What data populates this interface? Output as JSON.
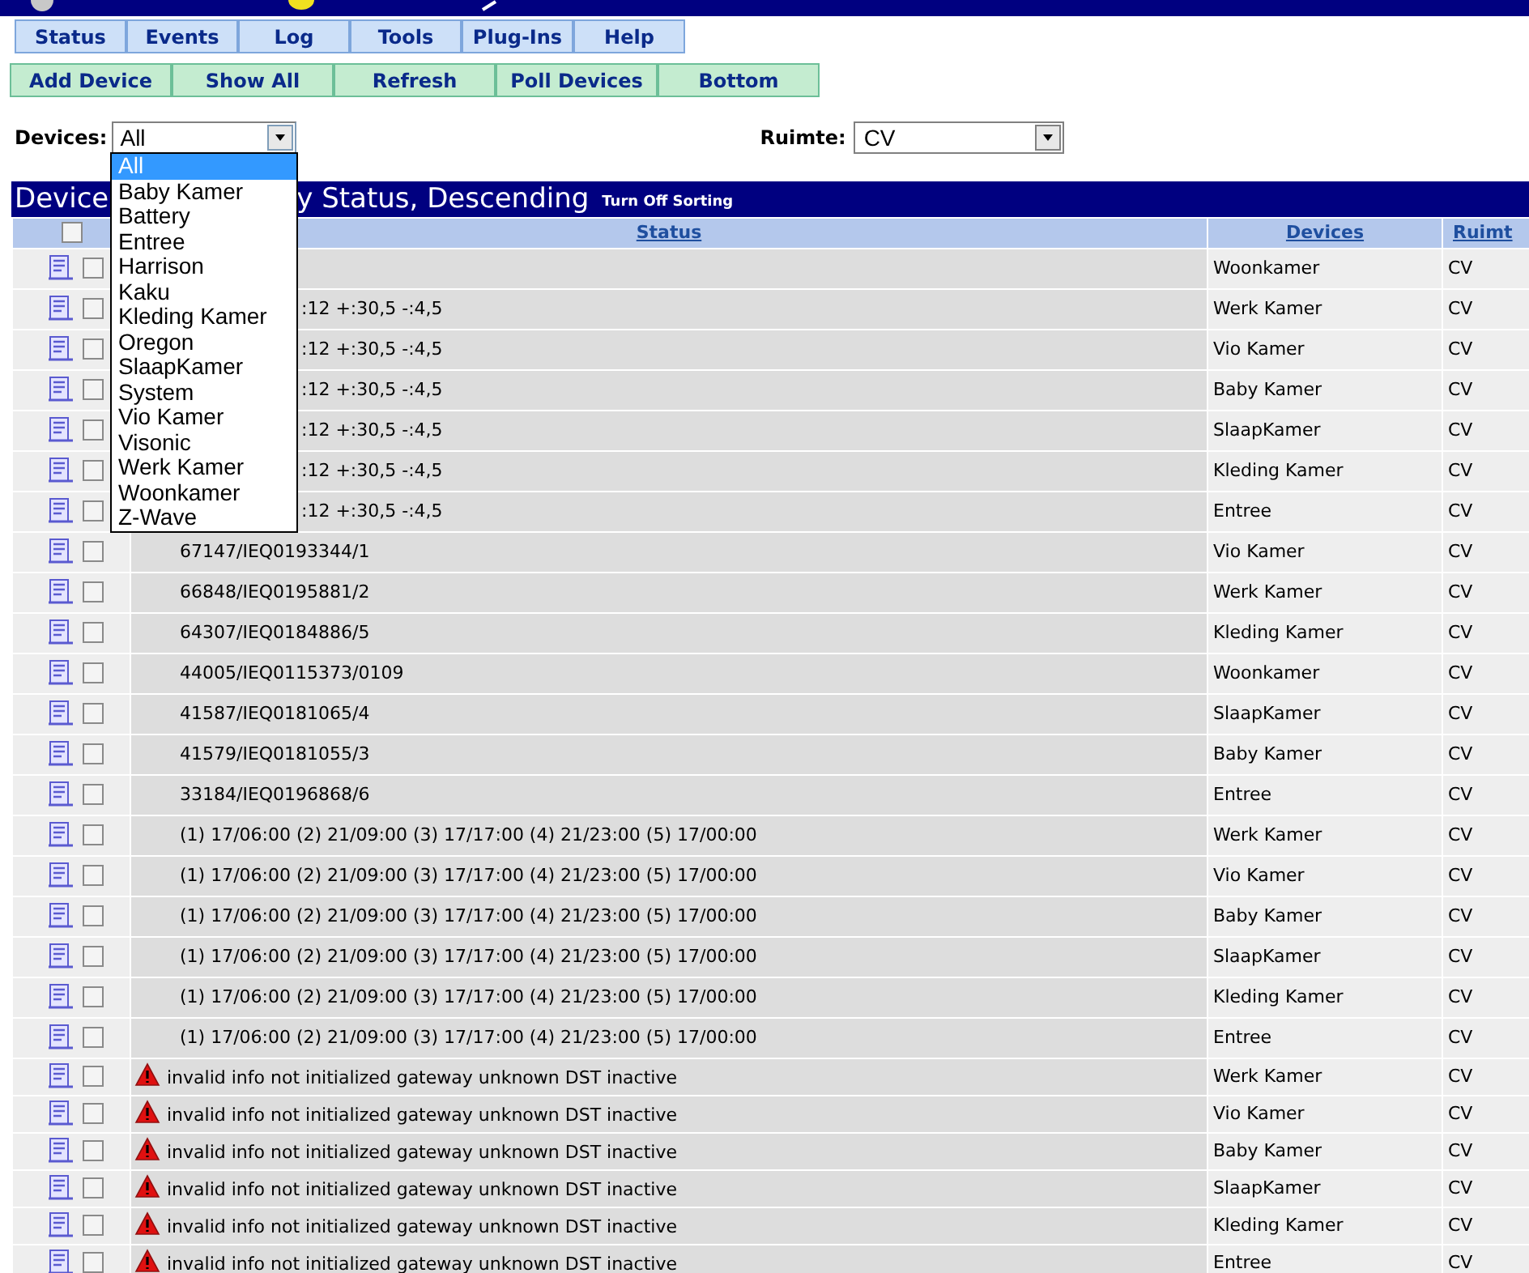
{
  "menu": [
    {
      "label": "Status"
    },
    {
      "label": "Events"
    },
    {
      "label": "Log"
    },
    {
      "label": "Tools"
    },
    {
      "label": "Plug-Ins"
    },
    {
      "label": "Help"
    }
  ],
  "actions": [
    {
      "label": "Add Device"
    },
    {
      "label": "Show All"
    },
    {
      "label": "Refresh"
    },
    {
      "label": "Poll Devices"
    },
    {
      "label": "Bottom"
    }
  ],
  "filters": {
    "devices_label": "Devices:",
    "devices_value": "All",
    "ruimte_label": "Ruimte:",
    "ruimte_value": "CV"
  },
  "devices_dropdown": [
    {
      "label": "All",
      "selected": true
    },
    {
      "label": "Baby Kamer",
      "selected": false
    },
    {
      "label": "Battery",
      "selected": false
    },
    {
      "label": "Entree",
      "selected": false
    },
    {
      "label": "Harrison",
      "selected": false
    },
    {
      "label": "Kaku",
      "selected": false
    },
    {
      "label": "Kleding Kamer",
      "selected": false
    },
    {
      "label": "Oregon",
      "selected": false
    },
    {
      "label": "SlaapKamer",
      "selected": false
    },
    {
      "label": "System",
      "selected": false
    },
    {
      "label": "Vio Kamer",
      "selected": false
    },
    {
      "label": "Visonic",
      "selected": false
    },
    {
      "label": "Werk Kamer",
      "selected": false
    },
    {
      "label": "Woonkamer",
      "selected": false
    },
    {
      "label": "Z-Wave",
      "selected": false
    }
  ],
  "table": {
    "title_left": "Device",
    "title_right": "y Status, Descending",
    "turn_off_sorting": "Turn Off Sorting",
    "select_all_checked": false,
    "columns": [
      "Status",
      "Devices",
      "Ruimt"
    ],
    "rows": [
      {
        "kind": "plain",
        "status": "",
        "device": "Woonkamer",
        "ruimte": "CV",
        "checked": false
      },
      {
        "kind": "partial",
        "status": ":12 +:30,5 -:4,5",
        "device": "Werk Kamer",
        "ruimte": "CV",
        "checked": false
      },
      {
        "kind": "partial",
        "status": ":12 +:30,5 -:4,5",
        "device": "Vio Kamer",
        "ruimte": "CV",
        "checked": false
      },
      {
        "kind": "partial",
        "status": ":12 +:30,5 -:4,5",
        "device": "Baby Kamer",
        "ruimte": "CV",
        "checked": false
      },
      {
        "kind": "partial",
        "status": ":12 +:30,5 -:4,5",
        "device": "SlaapKamer",
        "ruimte": "CV",
        "checked": false
      },
      {
        "kind": "partial",
        "status": ":12 +:30,5 -:4,5",
        "device": "Kleding Kamer",
        "ruimte": "CV",
        "checked": false
      },
      {
        "kind": "partial",
        "status": ":12 +:30,5 -:4,5",
        "device": "Entree",
        "ruimte": "CV",
        "checked": false
      },
      {
        "kind": "plain",
        "status": "67147/IEQ0193344/1",
        "device": "Vio Kamer",
        "ruimte": "CV",
        "checked": false
      },
      {
        "kind": "plain",
        "status": "66848/IEQ0195881/2",
        "device": "Werk Kamer",
        "ruimte": "CV",
        "checked": false
      },
      {
        "kind": "plain",
        "status": "64307/IEQ0184886/5",
        "device": "Kleding Kamer",
        "ruimte": "CV",
        "checked": false
      },
      {
        "kind": "plain",
        "status": "44005/IEQ0115373/0109",
        "device": "Woonkamer",
        "ruimte": "CV",
        "checked": false
      },
      {
        "kind": "plain",
        "status": "41587/IEQ0181065/4",
        "device": "SlaapKamer",
        "ruimte": "CV",
        "checked": false
      },
      {
        "kind": "plain",
        "status": "41579/IEQ0181055/3",
        "device": "Baby Kamer",
        "ruimte": "CV",
        "checked": false
      },
      {
        "kind": "plain",
        "status": "33184/IEQ0196868/6",
        "device": "Entree",
        "ruimte": "CV",
        "checked": false
      },
      {
        "kind": "plain",
        "status": "(1) 17/06:00 (2) 21/09:00 (3) 17/17:00 (4) 21/23:00 (5) 17/00:00",
        "device": "Werk Kamer",
        "ruimte": "CV",
        "checked": false
      },
      {
        "kind": "plain",
        "status": "(1) 17/06:00 (2) 21/09:00 (3) 17/17:00 (4) 21/23:00 (5) 17/00:00",
        "device": "Vio Kamer",
        "ruimte": "CV",
        "checked": false
      },
      {
        "kind": "plain",
        "status": "(1) 17/06:00 (2) 21/09:00 (3) 17/17:00 (4) 21/23:00 (5) 17/00:00",
        "device": "Baby Kamer",
        "ruimte": "CV",
        "checked": false
      },
      {
        "kind": "plain",
        "status": "(1) 17/06:00 (2) 21/09:00 (3) 17/17:00 (4) 21/23:00 (5) 17/00:00",
        "device": "SlaapKamer",
        "ruimte": "CV",
        "checked": false
      },
      {
        "kind": "plain",
        "status": "(1) 17/06:00 (2) 21/09:00 (3) 17/17:00 (4) 21/23:00 (5) 17/00:00",
        "device": "Kleding Kamer",
        "ruimte": "CV",
        "checked": false
      },
      {
        "kind": "plain",
        "status": "(1) 17/06:00 (2) 21/09:00 (3) 17/17:00 (4) 21/23:00 (5) 17/00:00",
        "device": "Entree",
        "ruimte": "CV",
        "checked": false
      },
      {
        "kind": "warning",
        "status": "invalid info not initialized gateway unknown DST inactive",
        "device": "Werk Kamer",
        "ruimte": "CV",
        "checked": false
      },
      {
        "kind": "warning",
        "status": "invalid info not initialized gateway unknown DST inactive",
        "device": "Vio Kamer",
        "ruimte": "CV",
        "checked": false
      },
      {
        "kind": "warning",
        "status": "invalid info not initialized gateway unknown DST inactive",
        "device": "Baby Kamer",
        "ruimte": "CV",
        "checked": false
      },
      {
        "kind": "warning",
        "status": "invalid info not initialized gateway unknown DST inactive",
        "device": "SlaapKamer",
        "ruimte": "CV",
        "checked": false
      },
      {
        "kind": "warning",
        "status": "invalid info not initialized gateway unknown DST inactive",
        "device": "Kleding Kamer",
        "ruimte": "CV",
        "checked": false
      },
      {
        "kind": "warning",
        "status": "invalid info not initialized gateway unknown DST inactive",
        "device": "Entree",
        "ruimte": "CV",
        "checked": false
      }
    ]
  }
}
